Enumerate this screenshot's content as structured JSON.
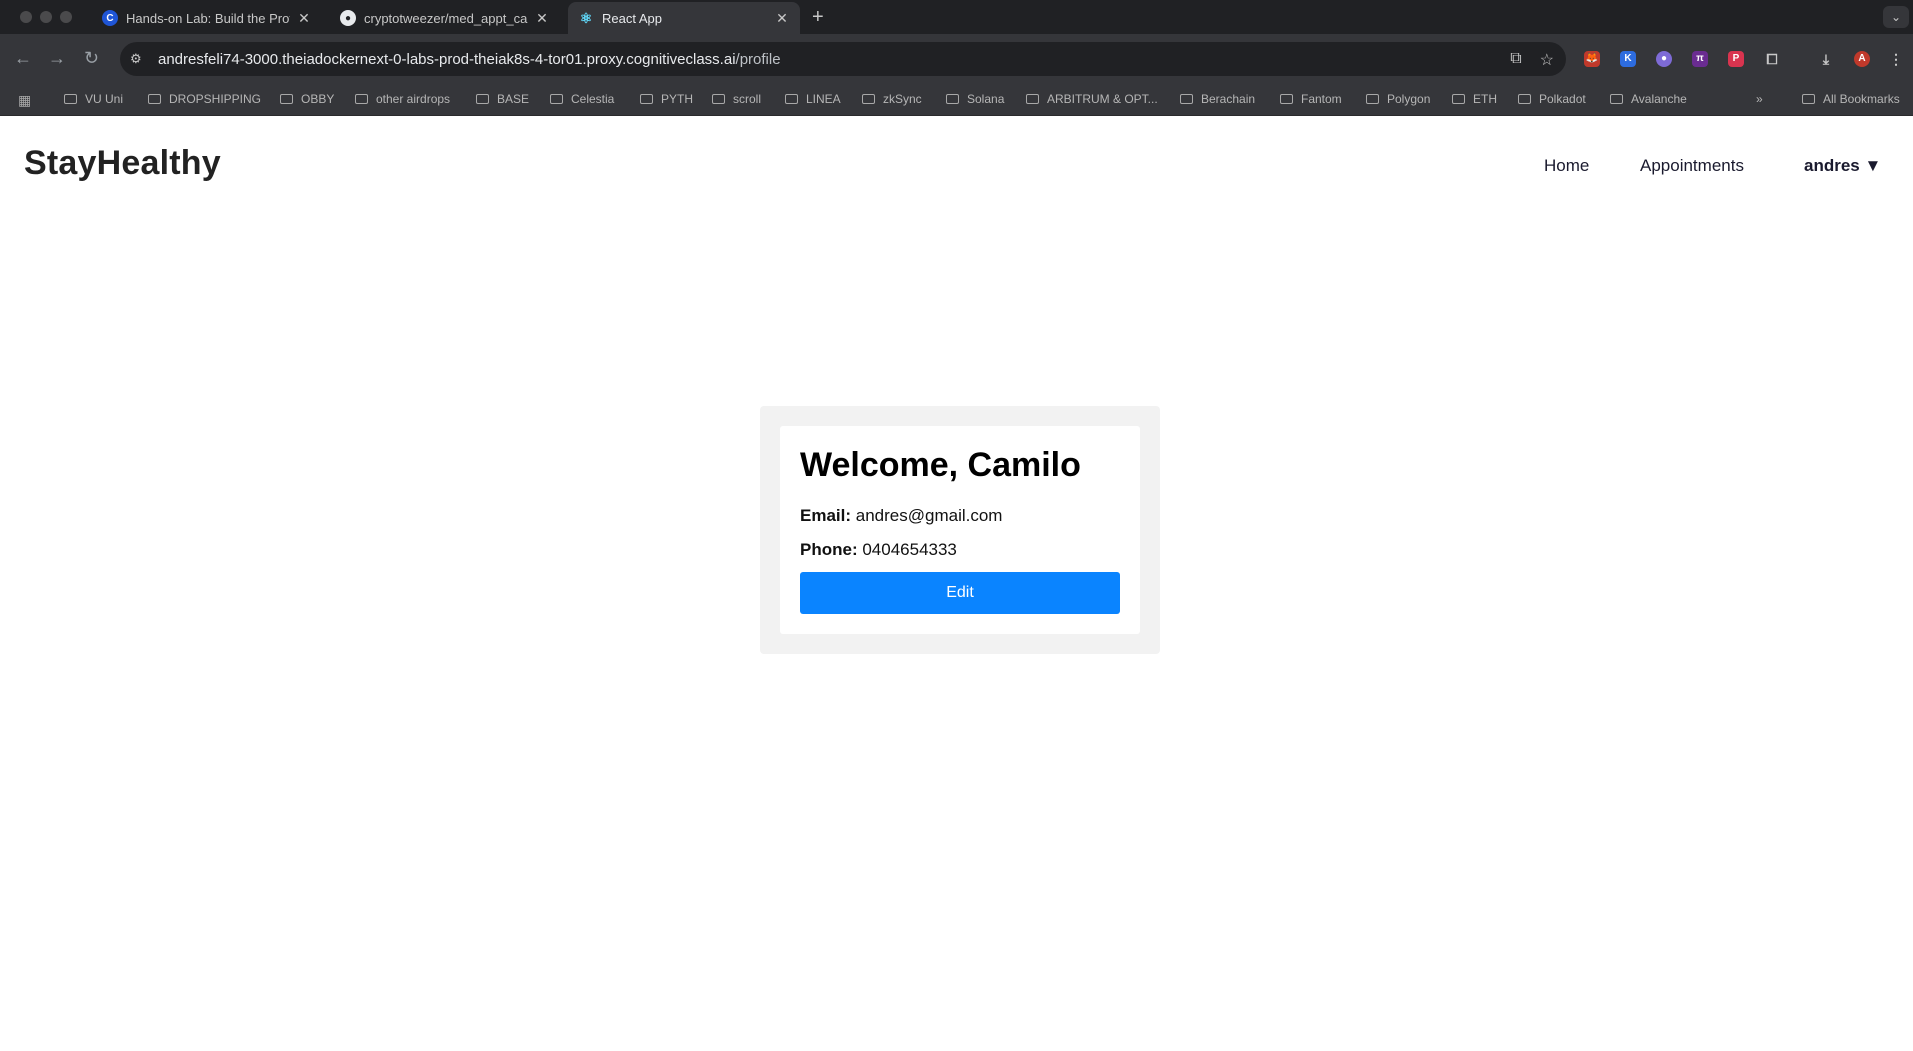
{
  "browser": {
    "tabs": [
      {
        "title": "Hands-on Lab: Build the Profi",
        "icon": "coursera-icon"
      },
      {
        "title": "cryptotweezer/med_appt_ca",
        "icon": "github-icon"
      },
      {
        "title": "React App",
        "icon": "react-icon"
      }
    ],
    "url_host": "andresfeli74-3000.theiadockernext-0-labs-prod-theiak8s-4-tor01.proxy.cognitiveclass.ai",
    "url_path": "/profile",
    "bookmarks": [
      "VU Uni",
      "DROPSHIPPING",
      "OBBY",
      "other airdrops",
      "BASE",
      "Celestia",
      "PYTH",
      "scroll",
      "LINEA",
      "zkSync",
      "Solana",
      "ARBITRUM & OPT...",
      "Berachain",
      "Fantom",
      "Polygon",
      "ETH",
      "Polkadot",
      "Avalanche"
    ],
    "all_bookmarks": "All Bookmarks",
    "more_bookmarks": "»",
    "profile_initial": "A"
  },
  "navbar": {
    "brand": "StayHealthy",
    "home": "Home",
    "appointments": "Appointments",
    "user": "andres",
    "dropdown_caret": "▼"
  },
  "profile": {
    "welcome": "Welcome, Camilo",
    "email_label": "Email:",
    "email_value": "andres@gmail.com",
    "phone_label": "Phone:",
    "phone_value": "0404654333",
    "edit_label": "Edit"
  },
  "colors": {
    "accent": "#0a84ff",
    "card_bg": "#f2f2f2",
    "chrome_dark": "#202124",
    "chrome_toolbar": "#35363a"
  }
}
